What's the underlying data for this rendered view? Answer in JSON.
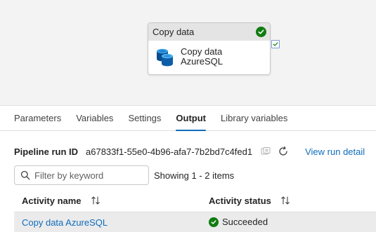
{
  "canvas": {
    "activity": {
      "header_title": "Copy data",
      "name_line1": "Copy data",
      "name_line2": "AzureSQL",
      "status_icon": "checkmark-circle-icon",
      "activity_icon": "azure-sql-database-icon"
    }
  },
  "tabs": [
    {
      "label": "Parameters",
      "active": false
    },
    {
      "label": "Variables",
      "active": false
    },
    {
      "label": "Settings",
      "active": false
    },
    {
      "label": "Output",
      "active": true
    },
    {
      "label": "Library variables",
      "active": false
    }
  ],
  "run": {
    "label": "Pipeline run ID",
    "id": "a67833f1-55e0-4b96-afa7-7b2bd7c4fed1",
    "view_link": "View run detail"
  },
  "search": {
    "placeholder": "Filter by keyword",
    "value": ""
  },
  "showing_text": "Showing 1 - 2 items",
  "table": {
    "columns": [
      "Activity name",
      "Activity status"
    ],
    "rows": [
      {
        "name": "Copy data AzureSQL",
        "status": "Succeeded"
      }
    ]
  },
  "colors": {
    "accent": "#0f6cbd",
    "success": "#107c10",
    "canvas_bg": "#f3f3f3"
  }
}
